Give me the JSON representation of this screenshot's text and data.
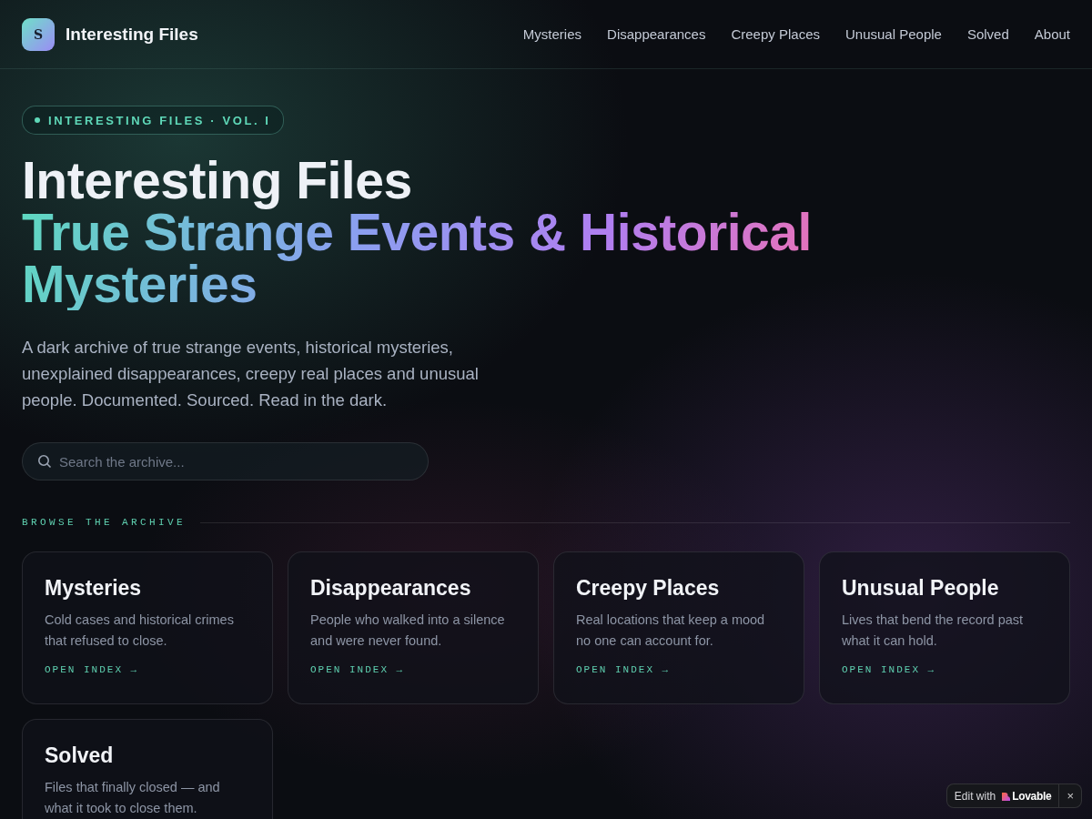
{
  "header": {
    "logo_letter": "S",
    "brand": "Interesting Files",
    "nav": [
      {
        "label": "Mysteries"
      },
      {
        "label": "Disappearances"
      },
      {
        "label": "Creepy Places"
      },
      {
        "label": "Unusual People"
      },
      {
        "label": "Solved"
      },
      {
        "label": "About"
      }
    ]
  },
  "hero": {
    "badge": "INTERESTING FILES · VOL. I",
    "title": "Interesting Files",
    "highlight": "True Strange Events & Historical Mysteries",
    "description": "A dark archive of true strange events, historical mysteries, unexplained disappearances, creepy real places and unusual people. Documented. Sourced. Read in the dark.",
    "search": {
      "placeholder": "Search the archive..."
    }
  },
  "browse": {
    "label": "BROWSE THE ARCHIVE",
    "cards": [
      {
        "title": "Mysteries",
        "description": "Cold cases and historical crimes that refused to close.",
        "link": "OPEN INDEX →"
      },
      {
        "title": "Disappearances",
        "description": "People who walked into a silence and were never found.",
        "link": "OPEN INDEX →"
      },
      {
        "title": "Creepy Places",
        "description": "Real locations that keep a mood no one can account for.",
        "link": "OPEN INDEX →"
      },
      {
        "title": "Unusual People",
        "description": "Lives that bend the record past what it can hold.",
        "link": "OPEN INDEX →"
      },
      {
        "title": "Solved",
        "description": "Files that finally closed — and what it took to close them."
      }
    ]
  },
  "edit_badge": {
    "label": "Edit with",
    "brand": "Lovable",
    "close": "×"
  }
}
